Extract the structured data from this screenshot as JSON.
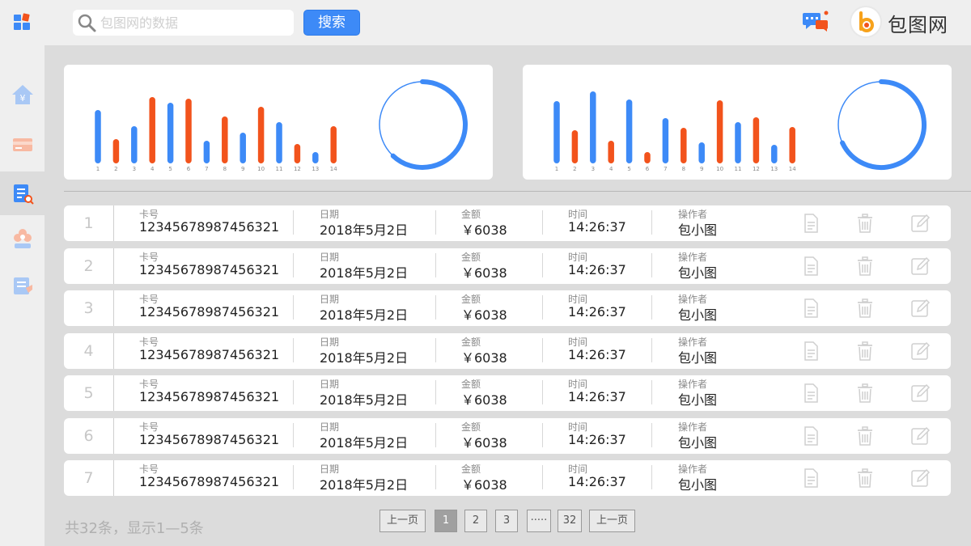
{
  "search": {
    "placeholder": "包图网的数据",
    "button_label": "搜索"
  },
  "brand": {
    "name": "包图网"
  },
  "colors": {
    "blue": "#3d8af7",
    "orange": "#f2531c",
    "background": "#dcdcdc"
  },
  "sidebar": {
    "items": [
      {
        "icon": "home-yen-icon"
      },
      {
        "icon": "card-icon"
      },
      {
        "icon": "report-search-icon",
        "active": true
      },
      {
        "icon": "settings-flower-icon"
      },
      {
        "icon": "notes-icon"
      }
    ]
  },
  "chart_data": [
    {
      "type": "bar",
      "categories": [
        "1",
        "2",
        "3",
        "4",
        "5",
        "6",
        "7",
        "8",
        "9",
        "10",
        "11",
        "12",
        "13",
        "14"
      ],
      "values": [
        66,
        30,
        46,
        82,
        75,
        80,
        28,
        58,
        38,
        70,
        51,
        24,
        14,
        46
      ],
      "bar_colors": [
        "blue",
        "orange",
        "blue",
        "orange",
        "blue",
        "orange",
        "blue",
        "orange",
        "blue",
        "orange",
        "blue",
        "orange",
        "blue",
        "orange"
      ],
      "ylim": [
        0,
        100
      ],
      "ring": {
        "percent": 0.62
      }
    },
    {
      "type": "bar",
      "categories": [
        "1",
        "2",
        "3",
        "4",
        "5",
        "6",
        "7",
        "8",
        "9",
        "10",
        "11",
        "12",
        "13",
        "14"
      ],
      "values": [
        77,
        41,
        89,
        28,
        79,
        14,
        56,
        44,
        26,
        78,
        51,
        57,
        23,
        45
      ],
      "bar_colors": [
        "blue",
        "orange",
        "blue",
        "orange",
        "blue",
        "orange",
        "blue",
        "orange",
        "blue",
        "orange",
        "blue",
        "orange",
        "blue",
        "orange"
      ],
      "ylim": [
        0,
        100
      ],
      "ring": {
        "percent": 0.68
      }
    }
  ],
  "table": {
    "labels": {
      "card": "卡号",
      "date": "日期",
      "amount": "金额",
      "time": "时间",
      "operator": "操作者"
    },
    "rows": [
      {
        "num": "1",
        "card": "12345678987456321",
        "date": "2018年5月2日",
        "amount": "￥6038",
        "time": "14:26:37",
        "operator": "包小图"
      },
      {
        "num": "2",
        "card": "12345678987456321",
        "date": "2018年5月2日",
        "amount": "￥6038",
        "time": "14:26:37",
        "operator": "包小图"
      },
      {
        "num": "3",
        "card": "12345678987456321",
        "date": "2018年5月2日",
        "amount": "￥6038",
        "time": "14:26:37",
        "operator": "包小图"
      },
      {
        "num": "4",
        "card": "12345678987456321",
        "date": "2018年5月2日",
        "amount": "￥6038",
        "time": "14:26:37",
        "operator": "包小图"
      },
      {
        "num": "5",
        "card": "12345678987456321",
        "date": "2018年5月2日",
        "amount": "￥6038",
        "time": "14:26:37",
        "operator": "包小图"
      },
      {
        "num": "6",
        "card": "12345678987456321",
        "date": "2018年5月2日",
        "amount": "￥6038",
        "time": "14:26:37",
        "operator": "包小图"
      },
      {
        "num": "7",
        "card": "12345678987456321",
        "date": "2018年5月2日",
        "amount": "￥6038",
        "time": "14:26:37",
        "operator": "包小图"
      }
    ]
  },
  "footer": {
    "summary": "共32条，显示1—5条",
    "pagination": [
      "上一页",
      "1",
      "2",
      "3",
      "·····",
      "32",
      "上一页"
    ]
  }
}
